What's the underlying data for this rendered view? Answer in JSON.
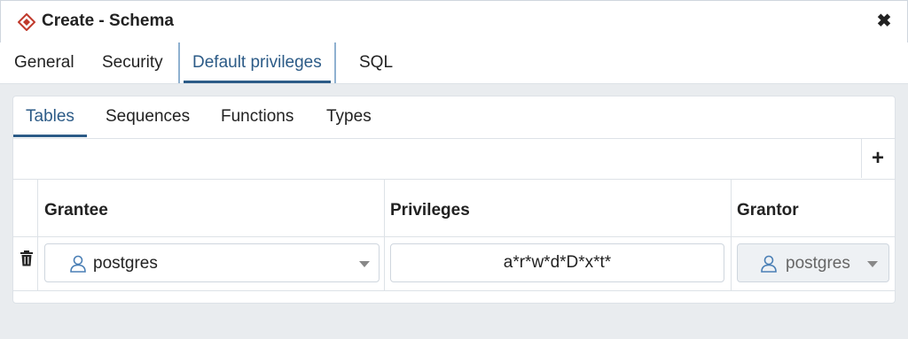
{
  "dialog": {
    "title": "Create - Schema",
    "close_glyph": "✖",
    "icon": "schema-icon",
    "accent_color": "#c0392b"
  },
  "tabs": [
    {
      "label": "General",
      "active": false
    },
    {
      "label": "Security",
      "active": false
    },
    {
      "label": "Default privileges",
      "active": true
    },
    {
      "label": "SQL",
      "active": false
    }
  ],
  "subtabs": [
    {
      "label": "Tables",
      "active": true
    },
    {
      "label": "Sequences",
      "active": false
    },
    {
      "label": "Functions",
      "active": false
    },
    {
      "label": "Types",
      "active": false
    }
  ],
  "grid": {
    "add_glyph": "+",
    "columns": [
      "Grantee",
      "Privileges",
      "Grantor"
    ],
    "rows": [
      {
        "grantee": "postgres",
        "privileges": "a*r*w*d*D*x*t*",
        "grantor": "postgres"
      }
    ]
  },
  "colors": {
    "active_tab": "#2c5b87",
    "user_icon": "#4a7fb5"
  }
}
